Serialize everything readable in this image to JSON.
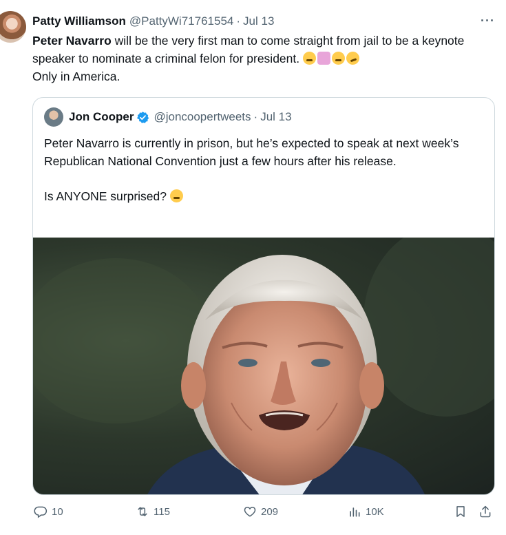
{
  "tweet": {
    "author_name": "Patty Williamson",
    "handle": "@PattyWi71761554",
    "separator": "·",
    "date": "Jul 13",
    "more_label": "···",
    "text_bold": "Peter Navarro",
    "text_rest": " will be the very first man to come straight from jail to be a keynote speaker to nominate a criminal felon for president. ",
    "text_line2": "Only in America.",
    "emojis": [
      "rolling-eyes-emoji",
      "woman-facepalming-emoji",
      "tears-of-joy-emoji",
      "rolling-on-floor-laughing-emoji"
    ]
  },
  "quote": {
    "author_name": "Jon Cooper",
    "handle": "@joncoopertweets",
    "separator": "·",
    "date": "Jul 13",
    "verified": true,
    "paragraph1": "Peter Navarro is currently in prison, but he’s expected to speak at next week’s Republican National Convention just a few hours after his release.",
    "paragraph2": "Is ANYONE surprised? ",
    "emoji": "face-with-raised-eyebrow-emoji"
  },
  "actions": {
    "replies": "10",
    "reposts": "115",
    "likes": "209",
    "views": "10K"
  },
  "colors": {
    "text": "#0f1419",
    "secondary": "#536471",
    "border": "#cfd9de",
    "verified_blue": "#1d9bf0"
  }
}
